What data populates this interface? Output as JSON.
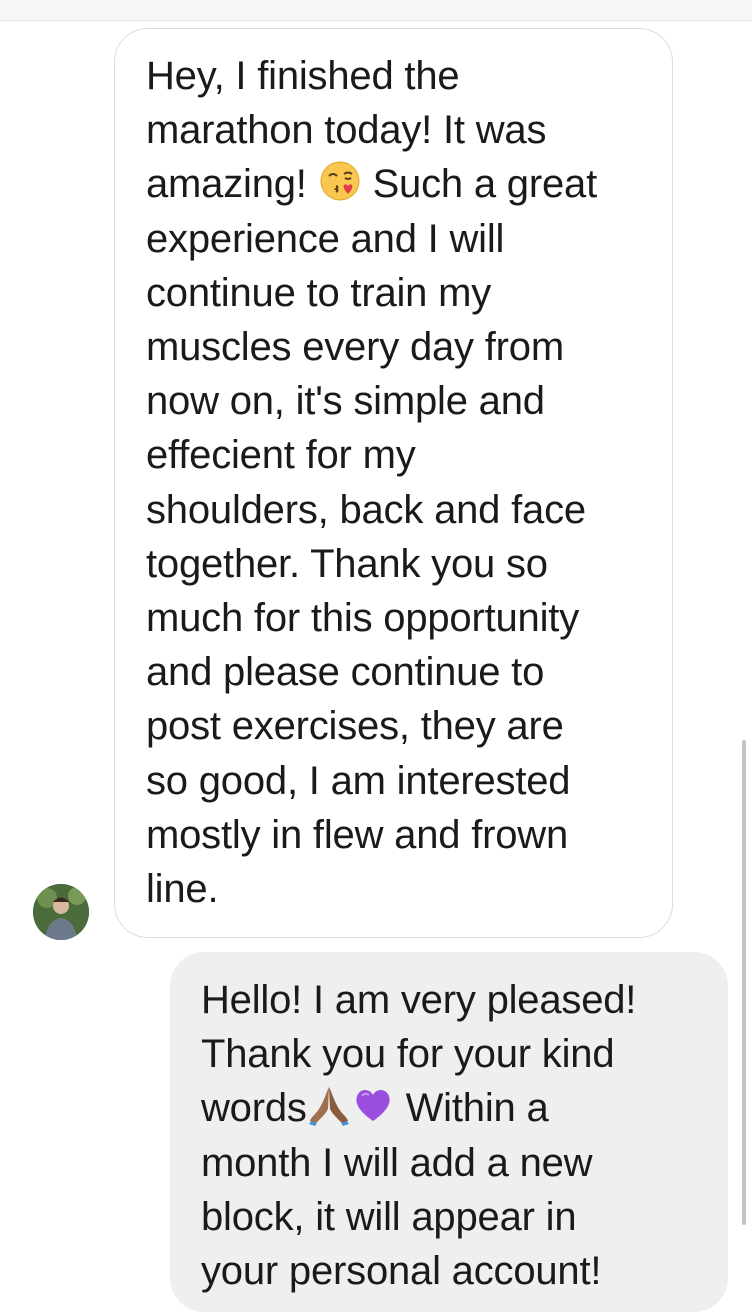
{
  "thread": {
    "incoming_message": {
      "lines": [
        "Hey, I finished the",
        "marathon today! It was",
        "amazing!",
        "Such a great",
        "experience and I will",
        "continue to train my",
        "muscles every day from",
        "now on, it's simple and",
        "effecient for my",
        "shoulders, back and face",
        "together. Thank you so",
        "much for this opportunity",
        "and please continue to",
        "post exercises, they are",
        "so good, I am interested",
        "mostly in flew and frown",
        "line."
      ],
      "emoji": "face-blowing-a-kiss"
    },
    "outgoing_message": {
      "lines": [
        "Hello!  I am very pleased!",
        "Thank you for your kind",
        "words",
        "Within a",
        "month I will add a new",
        "block, it will appear in",
        "your personal account!"
      ],
      "emojis": [
        "folded-hands-medium-dark-skin",
        "purple-heart"
      ]
    },
    "avatar_icon": "user-avatar-photo"
  },
  "colors": {
    "incoming_bubble_bg": "#ffffff",
    "incoming_bubble_border": "#dcdcdc",
    "outgoing_bubble_bg": "#efefef",
    "text": "#1a1a1a"
  }
}
